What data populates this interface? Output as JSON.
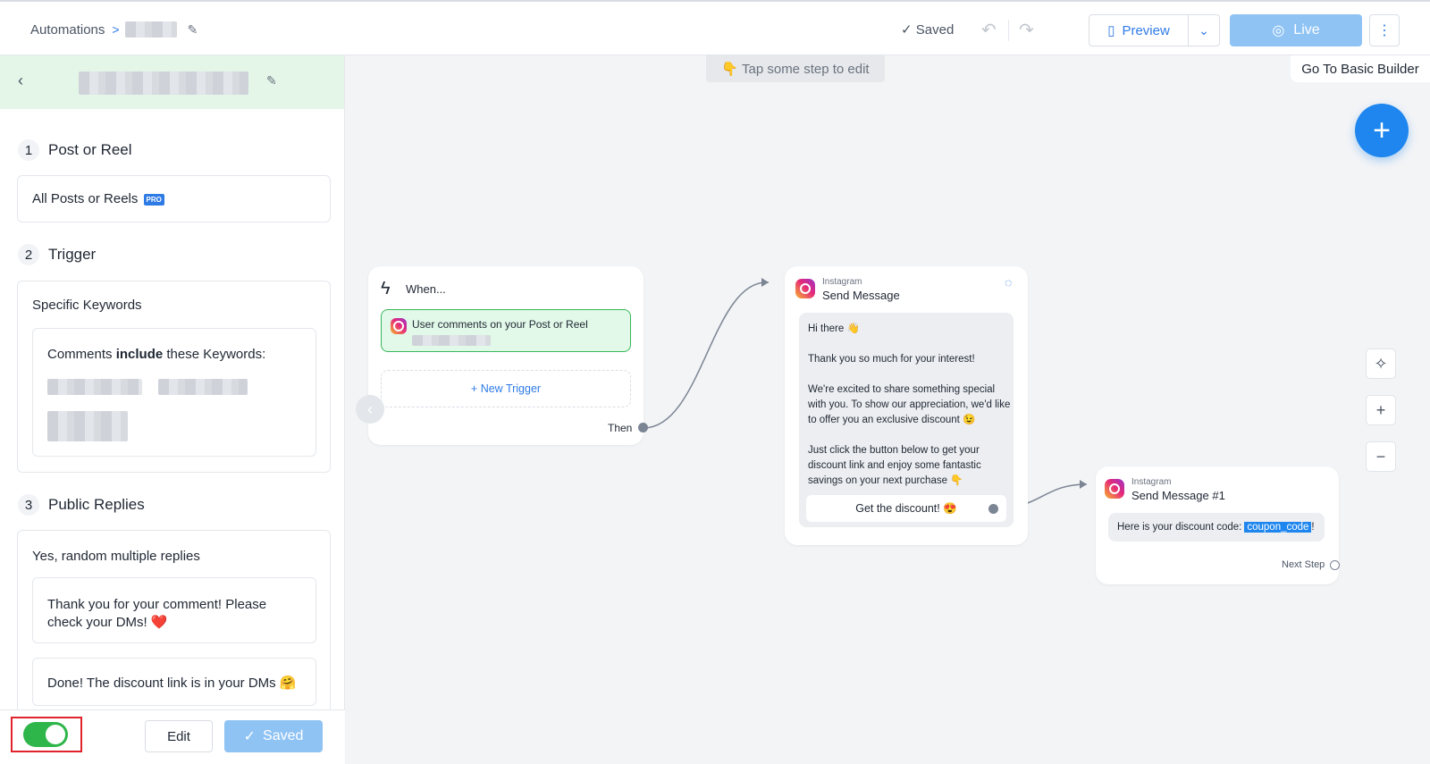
{
  "header": {
    "breadcrumb_root": "Automations",
    "saved_status": "Saved",
    "preview_label": "Preview",
    "live_label": "Live"
  },
  "panel": {
    "sections": [
      {
        "number": "1",
        "title": "Post or Reel",
        "value": "All Posts or Reels",
        "badge": "PRO"
      },
      {
        "number": "2",
        "title": "Trigger",
        "value": "Specific Keywords",
        "keywords_prefix": "Comments ",
        "keywords_bold": "include",
        "keywords_suffix": " these Keywords:"
      },
      {
        "number": "3",
        "title": "Public Replies",
        "value": "Yes, random multiple replies",
        "replies": [
          "Thank you for your comment! Please check your DMs! ❤️",
          "Done! The discount link is in your DMs 🤗"
        ]
      }
    ],
    "edit_label": "Edit",
    "saved_label": "Saved",
    "toggle_on": true
  },
  "canvas": {
    "hint": "👇 Tap some step to edit",
    "basic_builder": "Go To Basic Builder",
    "trigger_node": {
      "title": "When...",
      "trigger_text": "User comments on your Post or Reel",
      "new_trigger": "+ New Trigger",
      "then_label": "Then"
    },
    "message_node": {
      "platform": "Instagram",
      "title": "Send Message",
      "lines": [
        "Hi there 👋",
        "",
        "Thank you so much for your interest!",
        "",
        "We're excited to share something special",
        "with you. To show our appreciation, we'd like",
        "to offer you an exclusive discount 😉",
        "",
        "Just click the button below to get your",
        "discount link and enjoy some fantastic",
        "savings on your next purchase 👇"
      ],
      "button": "Get the discount! 😍"
    },
    "message_node_2": {
      "platform": "Instagram",
      "title": "Send Message #1",
      "text_prefix": "Here is your discount code: ",
      "code": "coupon_code",
      "text_suffix": "!",
      "next_step": "Next Step"
    }
  },
  "colors": {
    "accent": "#2f7be6",
    "live_button": "#8fc3f4",
    "toggle_on": "#2fb64a",
    "panel_header": "#e3f6e8",
    "trigger_highlight": "#e2f8e8",
    "highlight_border": "#e0242e"
  }
}
